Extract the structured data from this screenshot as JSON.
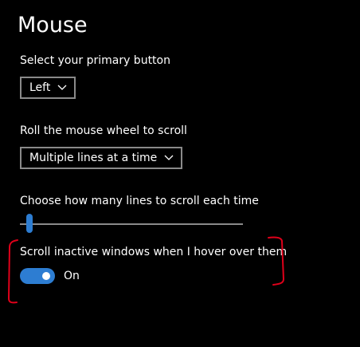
{
  "page": {
    "title": "Mouse"
  },
  "primary_button": {
    "label": "Select your primary button",
    "value": "Left"
  },
  "scroll_wheel": {
    "label": "Roll the mouse wheel to scroll",
    "value": "Multiple lines at a time"
  },
  "scroll_lines": {
    "label": "Choose how many lines to scroll each time",
    "level_fraction": 0.03
  },
  "inactive_scroll": {
    "label": "Scroll inactive windows when I hover over them",
    "state": "On"
  },
  "colors": {
    "accent": "#2d7dd2",
    "annotation": "#e0001a",
    "background": "#000000"
  }
}
